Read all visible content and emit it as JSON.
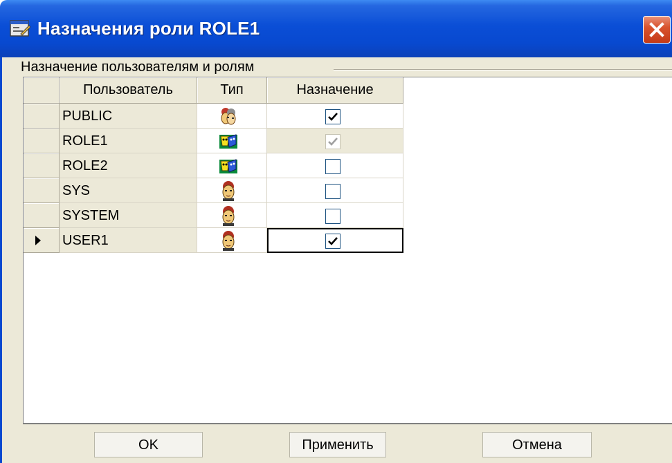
{
  "window": {
    "title": "Назначения роли ROLE1",
    "icon": "dialog-app-icon",
    "close_icon": "close-icon"
  },
  "group": {
    "label": "Назначение пользователям и ролям"
  },
  "grid": {
    "columns": [
      "Пользователь",
      "Тип",
      "Назначение"
    ],
    "rows": [
      {
        "name": "PUBLIC",
        "type": "group",
        "type_icon": "users-group-icon",
        "assigned": true,
        "enabled": true,
        "current": false,
        "focused": false
      },
      {
        "name": "ROLE1",
        "type": "role",
        "type_icon": "role-masks-icon",
        "assigned": true,
        "enabled": false,
        "current": false,
        "focused": false
      },
      {
        "name": "ROLE2",
        "type": "role",
        "type_icon": "role-masks-icon",
        "assigned": false,
        "enabled": true,
        "current": false,
        "focused": false
      },
      {
        "name": "SYS",
        "type": "user",
        "type_icon": "user-icon",
        "assigned": false,
        "enabled": true,
        "current": false,
        "focused": false
      },
      {
        "name": "SYSTEM",
        "type": "user",
        "type_icon": "user-icon",
        "assigned": false,
        "enabled": true,
        "current": false,
        "focused": false
      },
      {
        "name": "USER1",
        "type": "user",
        "type_icon": "user-icon",
        "assigned": true,
        "enabled": true,
        "current": true,
        "focused": true
      }
    ]
  },
  "buttons": {
    "ok": "OK",
    "apply": "Применить",
    "cancel": "Отмена"
  },
  "colors": {
    "titlebar": "#0849d0",
    "face": "#ece9d8",
    "close": "#d9542f"
  }
}
